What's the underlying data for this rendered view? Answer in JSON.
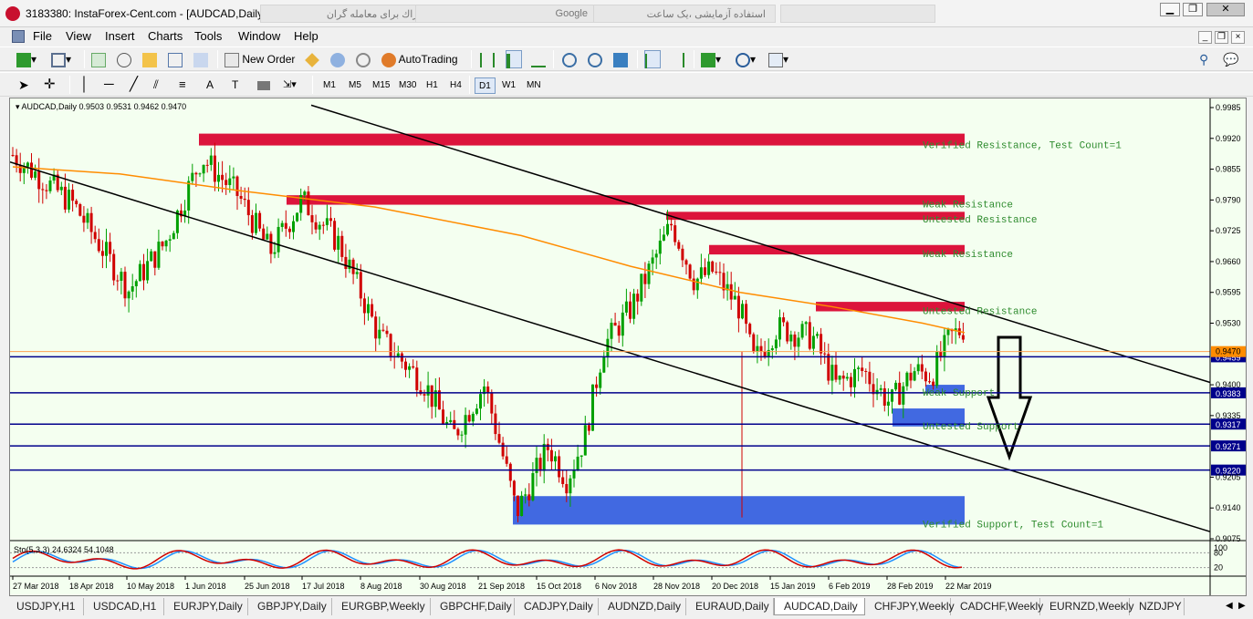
{
  "window": {
    "title": "3183380: InstaForex-Cent.com - [AUDCAD,Daily]",
    "browser_tabs": [
      "اشتراك برای معامله گران",
      "Google",
      "استفاده آزمایشی ،یک ساعت",
      ""
    ]
  },
  "menu": [
    "File",
    "View",
    "Insert",
    "Charts",
    "Tools",
    "Window",
    "Help"
  ],
  "toolbar": {
    "new_order": "New Order",
    "autotrading": "AutoTrading"
  },
  "timeframes": [
    "M1",
    "M5",
    "M15",
    "M30",
    "H1",
    "H4",
    "D1",
    "W1",
    "MN"
  ],
  "active_timeframe": "D1",
  "chart": {
    "header": "AUDCAD,Daily  0.9503 0.9531 0.9462 0.9470",
    "indicator_header": "Sto(5,3,3) 24.6324 54.1048",
    "indicator_levels": [
      "100",
      "80",
      "20"
    ],
    "price_labels": [
      "0.9985",
      "0.9920",
      "0.9855",
      "0.9790",
      "0.9725",
      "0.9660",
      "0.9595",
      "0.9530",
      "0.9400",
      "0.9335",
      "0.9205",
      "0.9140",
      "0.9075"
    ],
    "highlighted_prices": [
      {
        "label": "0.9459",
        "value": 0.9459
      },
      {
        "label": "0.9383",
        "value": 0.9383
      },
      {
        "label": "0.9317",
        "value": 0.9317
      },
      {
        "label": "0.9271",
        "value": 0.9271
      },
      {
        "label": "0.9220",
        "value": 0.922
      }
    ],
    "current_price_label": "0.9470",
    "date_labels": [
      "27 Mar 2018",
      "18 Apr 2018",
      "10 May 2018",
      "1 Jun 2018",
      "25 Jun 2018",
      "17 Jul 2018",
      "8 Aug 2018",
      "30 Aug 2018",
      "21 Sep 2018",
      "15 Oct 2018",
      "6 Nov 2018",
      "28 Nov 2018",
      "20 Dec 2018",
      "15 Jan 2019",
      "6 Feb 2019",
      "28 Feb 2019",
      "22 Mar 2019"
    ],
    "zones": [
      {
        "type": "resistance",
        "label": "Verified Resistance, Test Count=1",
        "top": 0.993,
        "bottom": 0.9905
      },
      {
        "type": "resistance",
        "label": "Weak Resistance",
        "top": 0.98,
        "bottom": 0.978
      },
      {
        "type": "resistance",
        "label": "Untested Resistance",
        "top": 0.9765,
        "bottom": 0.9748
      },
      {
        "type": "resistance",
        "label": "Weak Resistance",
        "top": 0.9695,
        "bottom": 0.9675
      },
      {
        "type": "resistance",
        "label": "Untested Resistance",
        "top": 0.9575,
        "bottom": 0.9555
      },
      {
        "type": "support",
        "label": "Weak Support",
        "top": 0.94,
        "bottom": 0.9383
      },
      {
        "type": "support",
        "label": "Untested Support",
        "top": 0.935,
        "bottom": 0.9312
      },
      {
        "type": "support",
        "label": "Verified Support, Test Count=1",
        "top": 0.9165,
        "bottom": 0.9105
      }
    ],
    "colors": {
      "background": "#f4fff0",
      "resistance": "#dc143c",
      "support": "#4169e1",
      "bull": "#00a000",
      "bear": "#d00000",
      "ma": "#ff8c00",
      "zone_text": "#2e8b2e"
    }
  },
  "symbol_tabs": [
    "USDJPY,H1",
    "USDCAD,H1",
    "EURJPY,Daily",
    "GBPJPY,Daily",
    "EURGBP,Weekly",
    "GBPCHF,Daily",
    "CADJPY,Daily",
    "AUDNZD,Daily",
    "EURAUD,Daily",
    "AUDCAD,Daily",
    "CHFJPY,Weekly",
    "CADCHF,Weekly",
    "EURNZD,Weekly",
    "NZDJPY"
  ],
  "active_symbol_tab": "AUDCAD,Daily"
}
